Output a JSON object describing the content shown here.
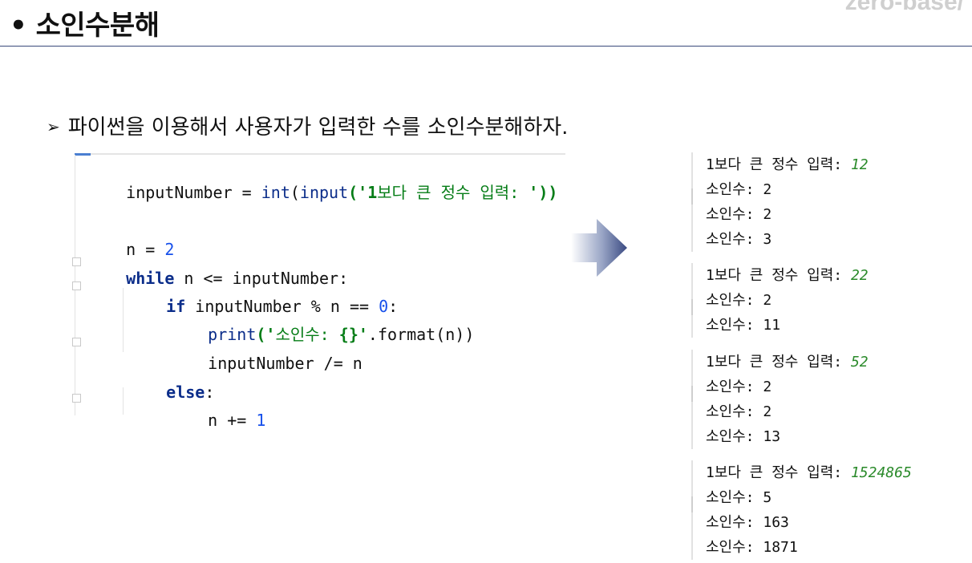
{
  "header": {
    "title": "• 소인수분해",
    "brand": "zero-base/"
  },
  "subtitle": {
    "bullet": "➢",
    "text": "파이썬을 이용해서 사용자가 입력한 수를 소인수분해하자."
  },
  "code": {
    "lines": [
      [
        "inputNumber = ",
        "int",
        "(",
        "input",
        "('",
        "1",
        "보다 큰 정수 입력: ",
        "'))"
      ],
      [
        "n = ",
        "2"
      ],
      [
        "while",
        " n <= inputNumber:"
      ],
      [
        "if",
        " inputNumber % n == ",
        "0",
        ":"
      ],
      [
        "print",
        "('",
        "소인수: ",
        "{}",
        "'",
        ".format(n))"
      ],
      [
        "inputNumber /= n"
      ],
      [
        "else",
        ":"
      ],
      [
        "n += ",
        "1"
      ]
    ]
  },
  "outputs": [
    {
      "prompt": "1보다 큰 정수 입력: ",
      "input": "12",
      "results": [
        "소인수: 2",
        "소인수: 2",
        "소인수: 3"
      ]
    },
    {
      "prompt": "1보다 큰 정수 입력: ",
      "input": "22",
      "results": [
        "소인수: 2",
        "소인수: 11"
      ]
    },
    {
      "prompt": "1보다 큰 정수 입력: ",
      "input": "52",
      "results": [
        "소인수: 2",
        "소인수: 2",
        "소인수: 13"
      ]
    },
    {
      "prompt": "1보다 큰 정수 입력: ",
      "input": "1524865",
      "results": [
        "소인수: 5",
        "소인수: 163",
        "소인수: 1871"
      ]
    }
  ],
  "colors": {
    "keyword": "#0b2d8a",
    "number": "#1750eb",
    "string": "#067d17",
    "output_value": "#2a8a2a",
    "rule": "#3a4a7a"
  }
}
